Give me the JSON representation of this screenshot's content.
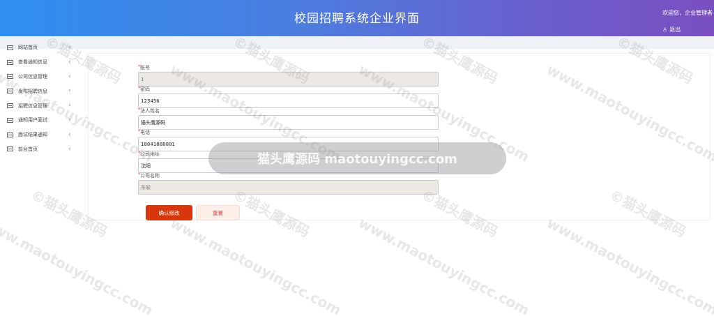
{
  "header": {
    "title": "校园招聘系统企业界面",
    "welcome": "欢迎您，企业管理者",
    "logout": "退出",
    "logout_icon": "user-icon"
  },
  "sidebar": {
    "items": [
      {
        "label": "网站首页"
      },
      {
        "label": "查看通知信息"
      },
      {
        "label": "公司信息管理"
      },
      {
        "label": "发布招聘信息"
      },
      {
        "label": "招聘信息管理"
      },
      {
        "label": "通知用户面试"
      },
      {
        "label": "面试结果通知"
      },
      {
        "label": "前台首页"
      }
    ]
  },
  "form": {
    "account": {
      "label": "账号",
      "value": "1"
    },
    "password": {
      "label": "密码",
      "value": "123456"
    },
    "legal_person": {
      "label": "法人姓名",
      "value": "猫头鹰源码"
    },
    "phone": {
      "label": "电话",
      "value": "18841888881"
    },
    "address": {
      "label": "公司地址",
      "value": "沈阳"
    },
    "company_name": {
      "label": "公司名称",
      "value": "东软"
    },
    "confirm_label": "确认修改",
    "reset_label": "重置"
  },
  "watermark": {
    "text": "©猫头鹰源码",
    "url": "www.maotouyingcc.com",
    "center": "猫头鹰源码 maotouyingcc.com"
  }
}
